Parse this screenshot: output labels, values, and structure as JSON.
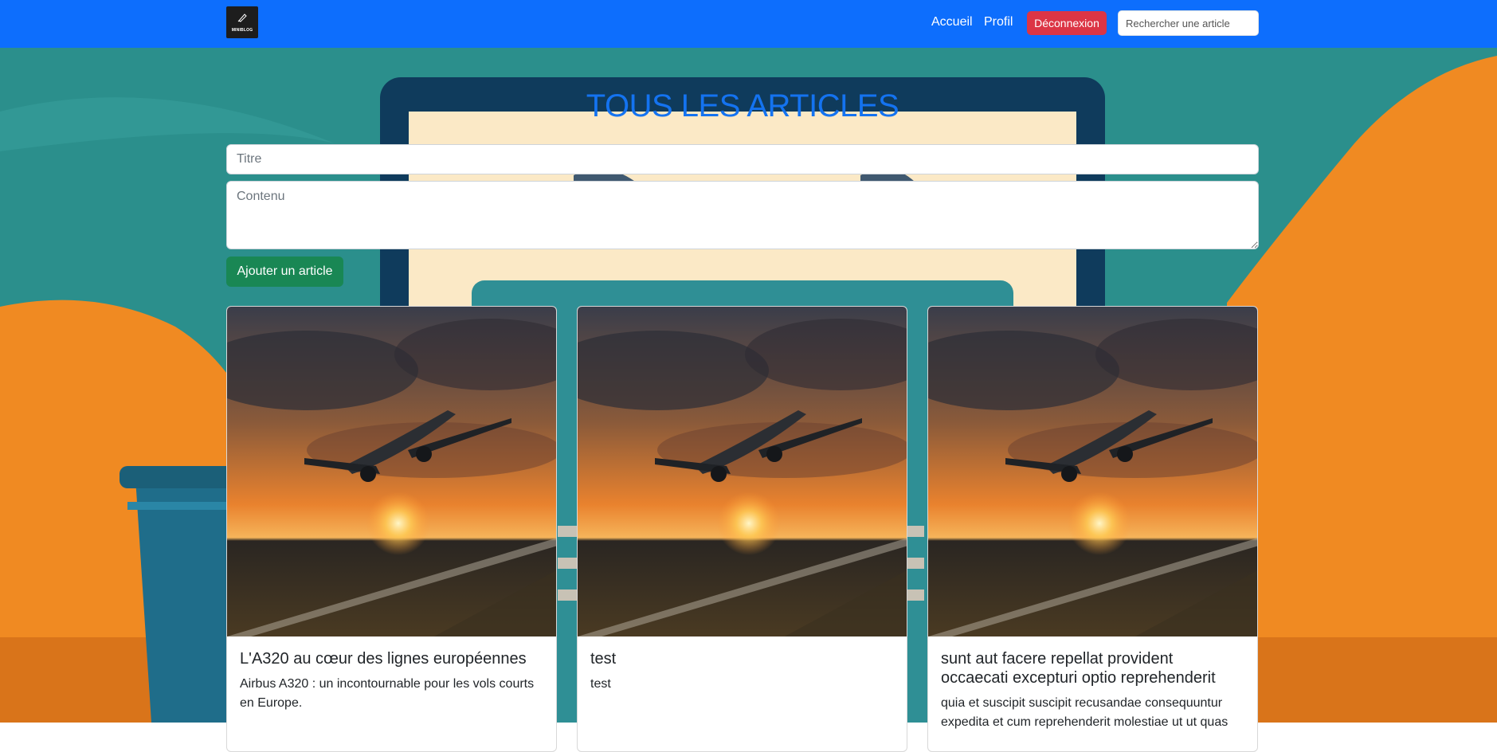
{
  "navbar": {
    "logo_text": "MINIBLOG",
    "links": [
      {
        "label": "Accueil"
      },
      {
        "label": "Profil"
      }
    ],
    "logout_label": "Déconnexion",
    "search_placeholder": "Rechercher une article"
  },
  "page": {
    "title": "TOUS LES ARTICLES"
  },
  "form": {
    "title_placeholder": "Titre",
    "content_placeholder": "Contenu",
    "submit_label": "Ajouter un article"
  },
  "articles": [
    {
      "title": "L'A320 au cœur des lignes européennes",
      "excerpt": "Airbus A320 : un incontournable pour les vols courts en Europe.",
      "image_icon": "airplane-sunset-image"
    },
    {
      "title": "test",
      "excerpt": "test",
      "image_icon": "airplane-sunset-image"
    },
    {
      "title": "sunt aut facere repellat provident occaecati excepturi optio reprehenderit",
      "excerpt": "quia et suscipit suscipit recusandae consequuntur expedita et cum reprehenderit molestiae ut ut quas",
      "image_icon": "airplane-sunset-image"
    }
  ],
  "colors": {
    "navbar": "#0d6efd",
    "title": "#1473f0",
    "danger": "#dc3545",
    "success": "#198754",
    "bg_teal": "#2b8f8c",
    "bg_orange": "#f08a22"
  }
}
